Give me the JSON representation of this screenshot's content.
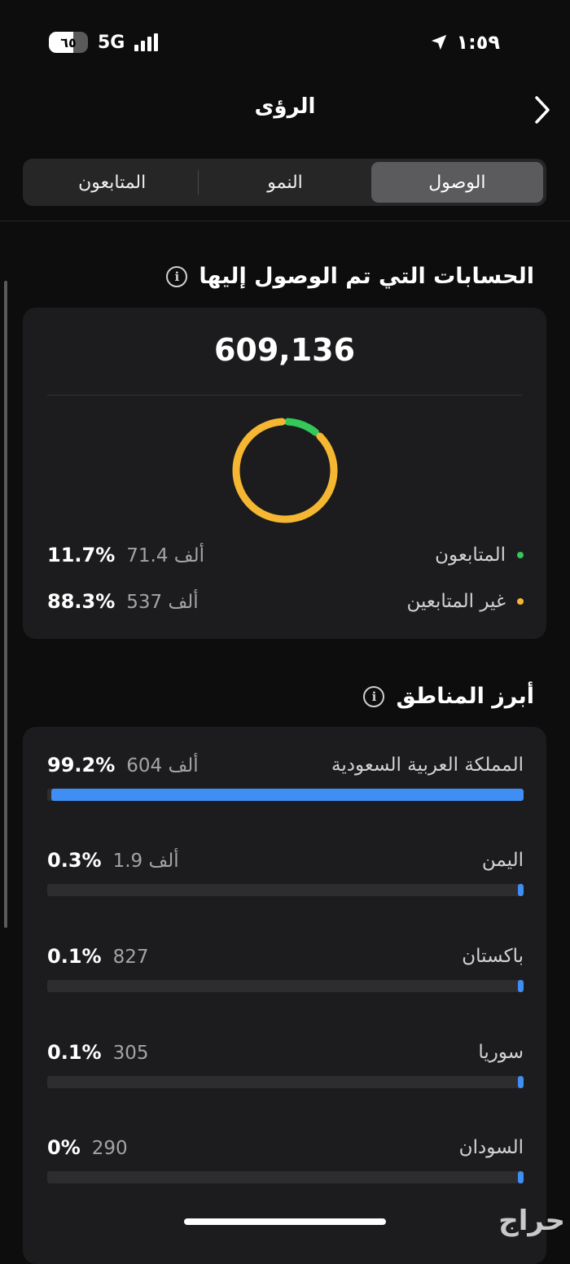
{
  "status_bar": {
    "time": "١:٥٩",
    "battery": "٦٥",
    "network": "5G"
  },
  "header": {
    "title": "الرؤى"
  },
  "tabs": [
    {
      "label": "الوصول",
      "active": true
    },
    {
      "label": "النمو",
      "active": false
    },
    {
      "label": "المتابعون",
      "active": false
    }
  ],
  "reach": {
    "title": "الحسابات التي تم الوصول إليها",
    "total": "609,136",
    "legend": [
      {
        "label": "المتابعون",
        "count": "71.4 ألف",
        "percent": "11.7%",
        "color": "#34c759",
        "fraction": 0.117
      },
      {
        "label": "غير المتابعين",
        "count": "537 ألف",
        "percent": "88.3%",
        "color": "#f5b731",
        "fraction": 0.883
      }
    ]
  },
  "regions": {
    "title": "أبرز المناطق",
    "bar_color": "#3f8ef3",
    "items": [
      {
        "name": "المملكة العربية السعودية",
        "count": "604 ألف",
        "percent": "99.2%",
        "fraction": 0.992
      },
      {
        "name": "اليمن",
        "count": "1.9 ألف",
        "percent": "0.3%",
        "fraction": 0.003
      },
      {
        "name": "باكستان",
        "count": "827",
        "percent": "0.1%",
        "fraction": 0.001
      },
      {
        "name": "سوريا",
        "count": "305",
        "percent": "0.1%",
        "fraction": 0.001
      },
      {
        "name": "السودان",
        "count": "290",
        "percent": "0%",
        "fraction": 0.0005
      }
    ]
  },
  "watermark": "حراج"
}
